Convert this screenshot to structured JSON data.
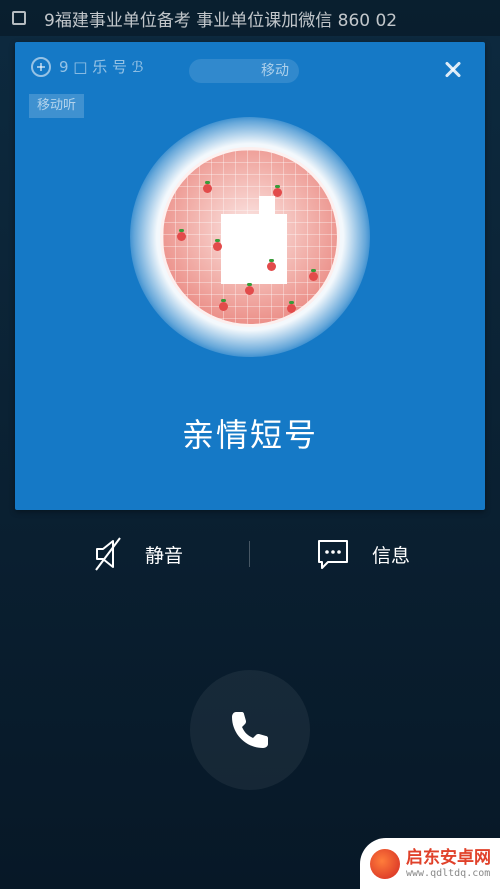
{
  "status_bar": {
    "notification_text": "9福建事业单位备考 事业单位课加微信 860 02"
  },
  "card": {
    "top_label": "9 □ 乐 号 ℬ",
    "pill_text": "移动",
    "tag_text": "移动听",
    "close_icon": "close-icon"
  },
  "caller": {
    "name": "亲情短号"
  },
  "actions": {
    "mute_label": "静音",
    "mute_icon": "mute-speaker-icon",
    "message_label": "信息",
    "message_icon": "message-bubble-icon"
  },
  "call_button": {
    "icon": "phone-handset-icon"
  },
  "watermark": {
    "title": "启东安卓网",
    "url": "www.qdltdq.com"
  },
  "colors": {
    "card_background": "#1579c6",
    "page_background": "#0b2234",
    "text": "#ffffff"
  }
}
